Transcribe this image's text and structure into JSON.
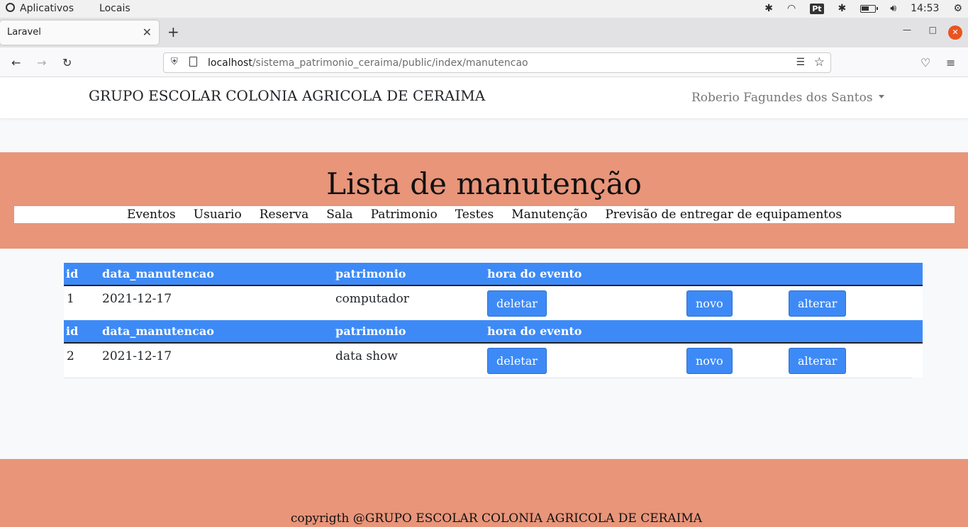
{
  "os": {
    "apps_label": "Aplicativos",
    "places_label": "Locais",
    "keyboard_layout": "Pt",
    "clock": "14:53"
  },
  "browser": {
    "tab_title": "Laravel",
    "url_host": "localhost",
    "url_path": "/sistema_patrimonio_ceraima/public/index/manutencao"
  },
  "header": {
    "brand": "GRUPO ESCOLAR COLONIA AGRICOLA DE CERAIMA",
    "user": "Roberio Fagundes dos Santos"
  },
  "banner": {
    "title": "Lista de manutenção",
    "menu": [
      "Eventos",
      "Usuario",
      "Reserva",
      "Sala",
      "Patrimonio",
      "Testes",
      "Manutenção",
      "Previsão de entregar de equipamentos"
    ]
  },
  "table": {
    "headers": [
      "id",
      "data_manutencao",
      "patrimonio",
      "hora do evento"
    ],
    "rows": [
      {
        "id": "1",
        "data": "2021-12-17",
        "patrimonio": "computador",
        "hora": ""
      },
      {
        "id": "2",
        "data": "2021-12-17",
        "patrimonio": "data show",
        "hora": ""
      }
    ],
    "buttons": {
      "delete": "deletar",
      "new": "novo",
      "edit": "alterar"
    }
  },
  "footer": {
    "copyright": "copyrigth @GRUPO ESCOLAR COLONIA AGRICOLA DE CERAIMA"
  },
  "colors": {
    "accent": "#e8957a",
    "table_header": "#3d8af7"
  }
}
